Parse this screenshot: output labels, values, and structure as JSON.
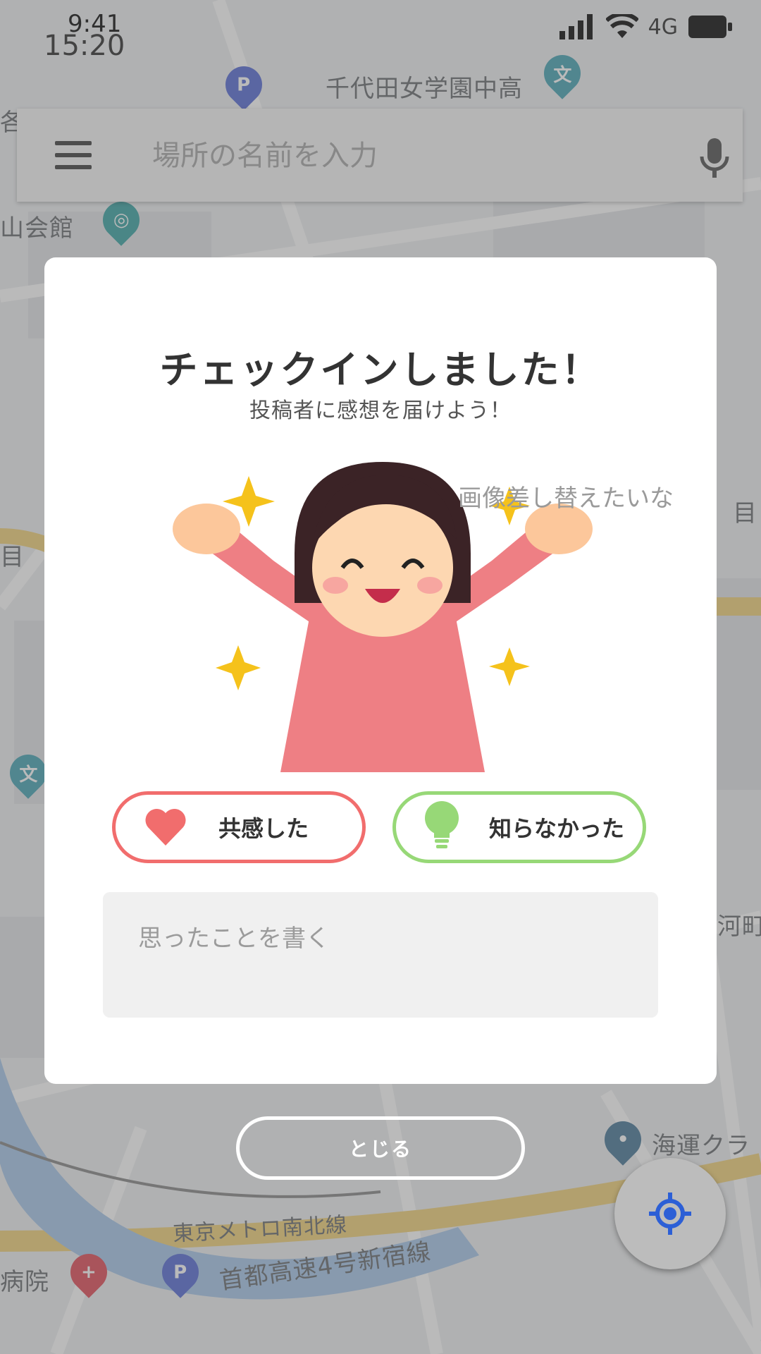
{
  "status_bar": {
    "time_overlay": "9:41",
    "time": "15:20",
    "network": "4G"
  },
  "search": {
    "placeholder": "場所の名前を入力"
  },
  "map": {
    "labels": [
      "千代田女学園中高",
      "山会館",
      "目",
      "河町",
      "海運クラ",
      "東京メトロ南北線",
      "首都高速4号新宿線",
      "病院",
      "各",
      "目"
    ]
  },
  "modal": {
    "title": "チェックインしました！",
    "subtitle": "投稿者に感想を届けよう！",
    "note": "画像差し替えたいな",
    "buttons": {
      "empathy": "共感した",
      "learned": "知らなかった"
    },
    "comment_placeholder": "思ったことを書く"
  },
  "close_label": "とじる",
  "colors": {
    "empathy": "#f16d6d",
    "learned": "#97d877",
    "locate": "#2c5fd6"
  },
  "icons": [
    "menu-icon",
    "mic-icon",
    "heart-icon",
    "lightbulb-icon",
    "location-target-icon"
  ]
}
